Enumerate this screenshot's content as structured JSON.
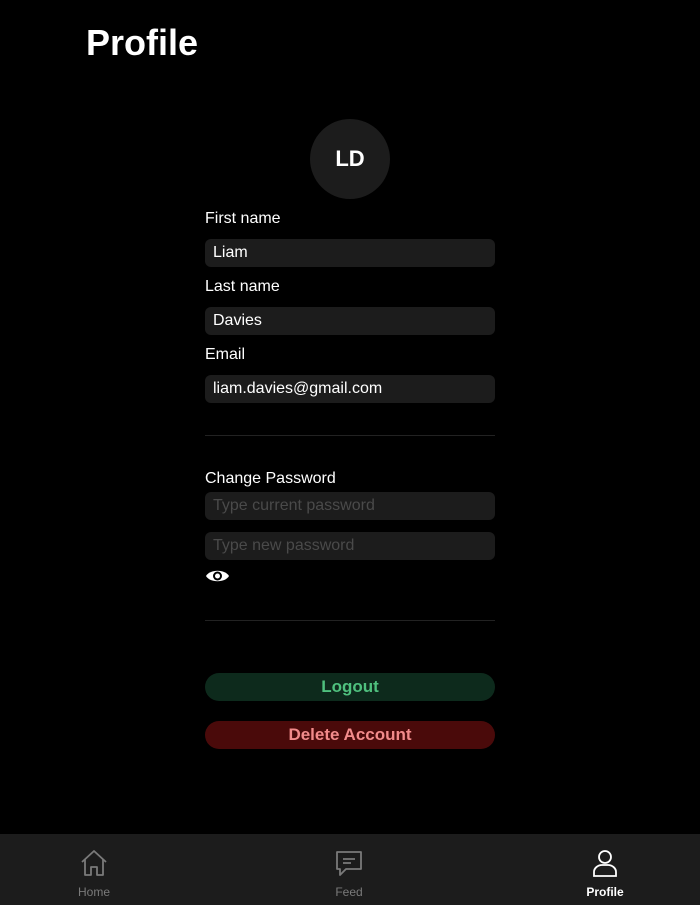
{
  "header": {
    "title": "Profile"
  },
  "avatar": {
    "initials": "LD"
  },
  "profile": {
    "first_name_label": "First name",
    "first_name_value": "Liam",
    "last_name_label": "Last name",
    "last_name_value": "Davies",
    "email_label": "Email",
    "email_value": "liam.davies@gmail.com"
  },
  "password": {
    "section_label": "Change Password",
    "current_placeholder": "Type current password",
    "new_placeholder": "Type new password",
    "toggle_icon": "eye-icon"
  },
  "actions": {
    "logout_label": "Logout",
    "delete_label": "Delete Account",
    "logout_color": "#4fc07e",
    "delete_color": "#f28b8b"
  },
  "tabbar": {
    "items": [
      {
        "label": "Home",
        "icon": "home-icon",
        "active": false
      },
      {
        "label": "Feed",
        "icon": "chat-icon",
        "active": false
      },
      {
        "label": "Profile",
        "icon": "user-icon",
        "active": true
      }
    ]
  }
}
